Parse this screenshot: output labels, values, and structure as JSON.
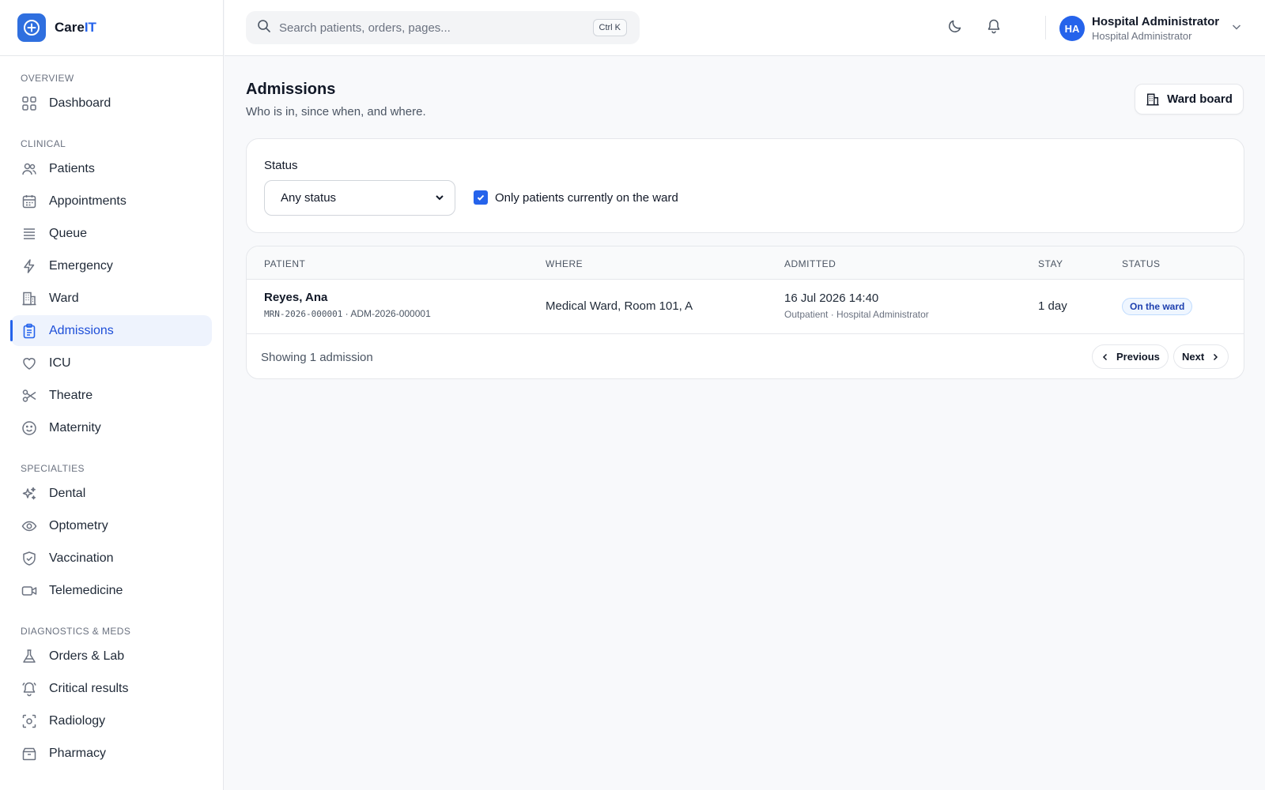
{
  "brand": {
    "name_prefix": "Care",
    "name_suffix": "IT",
    "logo_icon": "plus-circle-icon",
    "accent": "#2f6fdf"
  },
  "sidebar": {
    "sections": [
      {
        "title": "OVERVIEW",
        "items": [
          {
            "label": "Dashboard",
            "icon": "grid-icon"
          }
        ]
      },
      {
        "title": "CLINICAL",
        "items": [
          {
            "label": "Patients",
            "icon": "users-icon"
          },
          {
            "label": "Appointments",
            "icon": "calendar-icon"
          },
          {
            "label": "Queue",
            "icon": "list-icon"
          },
          {
            "label": "Emergency",
            "icon": "lightning-icon"
          },
          {
            "label": "Ward",
            "icon": "building-icon"
          },
          {
            "label": "Admissions",
            "icon": "clipboard-icon",
            "active": true
          },
          {
            "label": "ICU",
            "icon": "heart-icon"
          },
          {
            "label": "Theatre",
            "icon": "scissors-icon"
          },
          {
            "label": "Maternity",
            "icon": "smile-icon"
          }
        ]
      },
      {
        "title": "SPECIALTIES",
        "items": [
          {
            "label": "Dental",
            "icon": "sparkles-icon"
          },
          {
            "label": "Optometry",
            "icon": "eye-icon"
          },
          {
            "label": "Vaccination",
            "icon": "shield-check-icon"
          },
          {
            "label": "Telemedicine",
            "icon": "video-icon"
          }
        ]
      },
      {
        "title": "DIAGNOSTICS & MEDS",
        "items": [
          {
            "label": "Orders & Lab",
            "icon": "flask-icon"
          },
          {
            "label": "Critical results",
            "icon": "bell-alert-icon"
          },
          {
            "label": "Radiology",
            "icon": "scan-icon"
          },
          {
            "label": "Pharmacy",
            "icon": "pill-box-icon"
          }
        ]
      }
    ]
  },
  "header": {
    "search": {
      "placeholder": "Search patients, orders, pages...",
      "shortcut": "Ctrl K"
    },
    "user": {
      "initials": "HA",
      "name": "Hospital Administrator",
      "role": "Hospital Administrator"
    }
  },
  "page": {
    "title": "Admissions",
    "subtitle": "Who is in, since when, and where.",
    "ward_board_label": "Ward board"
  },
  "filters": {
    "status_label": "Status",
    "status_value": "Any status",
    "status_options": [
      "Any status"
    ],
    "checkbox_label": "Only patients currently on the ward",
    "checkbox_checked": true
  },
  "table": {
    "columns": [
      "PATIENT",
      "WHERE",
      "ADMITTED",
      "STAY",
      "STATUS"
    ],
    "rows": [
      {
        "patient_name": "Reyes, Ana",
        "mrn": "MRN-2026-000001",
        "adm_id": " · ADM-2026-000001",
        "where": "Medical Ward, Room 101, A",
        "admitted_date": "16 Jul 2026 14:40",
        "admitted_meta": "Outpatient · Hospital Administrator",
        "stay": "1 day",
        "status": "On the ward"
      }
    ],
    "footer": "Showing 1 admission",
    "prev_label": "Previous",
    "next_label": "Next"
  }
}
